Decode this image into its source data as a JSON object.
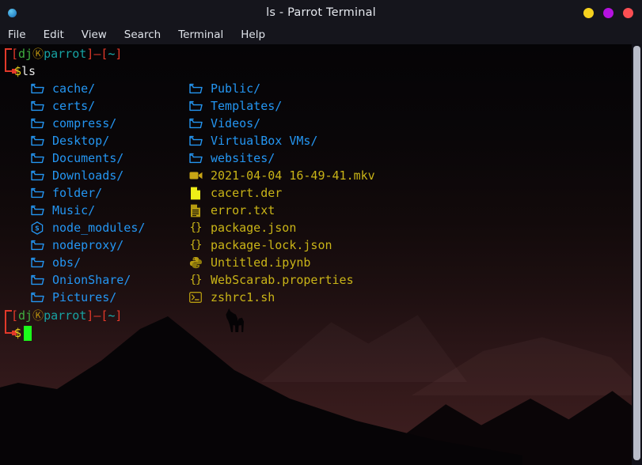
{
  "window": {
    "title": "ls - Parrot Terminal",
    "app_dot_icon": "blue-dot-icon",
    "controls": [
      {
        "name": "minimize",
        "label": "",
        "color": "#f5d11e"
      },
      {
        "name": "maximize",
        "label": "",
        "color": "#b512e0"
      },
      {
        "name": "close",
        "label": "",
        "color": "#fb4f53"
      }
    ]
  },
  "menubar": {
    "items": [
      {
        "label": "File"
      },
      {
        "label": "Edit"
      },
      {
        "label": "View"
      },
      {
        "label": "Search"
      },
      {
        "label": "Terminal"
      },
      {
        "label": "Help"
      }
    ]
  },
  "prompt": {
    "open_bracket": "[",
    "user": "dj",
    "at": "Ⓚ",
    "host": "parrot",
    "close_bracket": "]",
    "dash": "–",
    "path_open": "[",
    "path": "~",
    "path_close": "]",
    "symbol": "$",
    "command": "ls",
    "command_empty": ""
  },
  "colors": {
    "directory": "#2496f2",
    "file": "#c9b417",
    "prompt_bracket": "#e2392a",
    "prompt_user": "#3fae3f",
    "prompt_host": "#17a3a3",
    "prompt_dollar": "#e8d21c",
    "cursor": "#1bfc1b",
    "terminal_bg": "#000000",
    "titlebar_bg": "#15151c"
  },
  "listing": {
    "column1": [
      {
        "name": "cache/",
        "type": "dir",
        "icon": "folder-icon"
      },
      {
        "name": "certs/",
        "type": "dir",
        "icon": "folder-icon"
      },
      {
        "name": "compress/",
        "type": "dir",
        "icon": "folder-icon"
      },
      {
        "name": "Desktop/",
        "type": "dir",
        "icon": "folder-icon"
      },
      {
        "name": "Documents/",
        "type": "dir",
        "icon": "folder-icon"
      },
      {
        "name": "Downloads/",
        "type": "dir",
        "icon": "folder-icon"
      },
      {
        "name": "folder/",
        "type": "dir",
        "icon": "folder-icon"
      },
      {
        "name": "Music/",
        "type": "dir",
        "icon": "folder-icon"
      },
      {
        "name": "node_modules/",
        "type": "dir",
        "icon": "nodejs-hexagon-icon"
      },
      {
        "name": "nodeproxy/",
        "type": "dir",
        "icon": "folder-icon"
      },
      {
        "name": "obs/",
        "type": "dir",
        "icon": "folder-icon"
      },
      {
        "name": "OnionShare/",
        "type": "dir",
        "icon": "folder-icon"
      },
      {
        "name": "Pictures/",
        "type": "dir",
        "icon": "folder-icon"
      }
    ],
    "column2": [
      {
        "name": "Public/",
        "type": "dir",
        "icon": "folder-icon"
      },
      {
        "name": "Templates/",
        "type": "dir",
        "icon": "folder-icon"
      },
      {
        "name": "Videos/",
        "type": "dir",
        "icon": "folder-icon"
      },
      {
        "name": "VirtualBox VMs/",
        "type": "dir",
        "icon": "folder-icon"
      },
      {
        "name": "websites/",
        "type": "dir",
        "icon": "folder-icon"
      },
      {
        "name": "2021-04-04 16-49-41.mkv",
        "type": "file",
        "icon": "video-camera-icon"
      },
      {
        "name": "cacert.der",
        "type": "file",
        "icon": "page-icon"
      },
      {
        "name": "error.txt",
        "type": "file",
        "icon": "text-document-icon"
      },
      {
        "name": "package.json",
        "type": "file",
        "icon": "braces-json-icon"
      },
      {
        "name": "package-lock.json",
        "type": "file",
        "icon": "braces-json-icon"
      },
      {
        "name": "Untitled.ipynb",
        "type": "file",
        "icon": "python-icon"
      },
      {
        "name": "WebScarab.properties",
        "type": "file",
        "icon": "braces-json-icon"
      },
      {
        "name": "zshrc1.sh",
        "type": "file",
        "icon": "shell-script-icon"
      }
    ]
  },
  "scrollbar": {
    "name": "vertical-scrollbar"
  }
}
